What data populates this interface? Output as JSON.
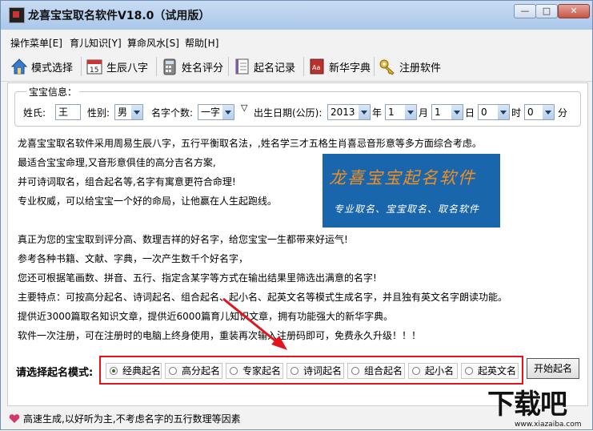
{
  "window": {
    "title": "龙喜宝宝取名软件V18.0（试用版）",
    "min_label": "—",
    "max_label": "□",
    "close_label": "✕"
  },
  "menu": [
    "操作菜单[E]",
    "育儿知识[Y]",
    "算命风水[S]",
    "帮助[H]"
  ],
  "toolbar": [
    {
      "label": "模式选择",
      "icon": "house-icon"
    },
    {
      "label": "生辰八字",
      "icon": "calendar-icon"
    },
    {
      "label": "姓名评分",
      "icon": "calculator-icon"
    },
    {
      "label": "起名记录",
      "icon": "notebook-icon"
    },
    {
      "label": "新华字典",
      "icon": "dictionary-icon"
    },
    {
      "label": "注册软件",
      "icon": "key-icon"
    }
  ],
  "baby_info": {
    "legend": "宝宝信息：",
    "surname_label": "姓氏:",
    "surname_value": "王",
    "gender_label": "性别:",
    "gender_value": "男",
    "name_count_label": "名字个数:",
    "name_count_value": "一字",
    "birthdate_label": "出生日期(公历):",
    "year": "2013",
    "year_unit": "年",
    "month": "1",
    "month_unit": "月",
    "day": "1",
    "day_unit": "日",
    "hour": "0",
    "hour_unit": "时",
    "minute": "0",
    "minute_unit": "分"
  },
  "description": {
    "p1": "龙喜宝宝取名软件采用周易生辰八字，五行平衡取名法，,姓名学三才五格生肖喜忌音形意等多方面综合考虑。",
    "p2": "最适合宝宝命理,又音形意俱佳的高分吉名方案,",
    "p3": "并可诗词取名，组合起名等,名字有寓意更符合命理!",
    "p4": "专业权威，可以给宝宝一个好的命局，让他赢在人生起跑线。",
    "p5": "真正为您的宝宝取到评分高、数理吉祥的好名字，给您宝宝一生都带来好运气!",
    "p6": "参考各种书籍、文献、字典，一次产生数千个好名字，",
    "p7": "您还可根据笔画数、拼音、五行、指定含某字等方式在输出结果里筛选出满意的名字!",
    "p8": "主要特点：可按高分起名、诗词起名、组合起名、起小名、起英文名等模式生成名字，并且独有英文名字朗读功能。",
    "p9": "提供近3000篇取名知识文章，提供近6000篇育儿知识文章，拥有功能强大的新华字典。",
    "p10": "软件一次注册，可在注册时的电脑上终身使用，重装再次输入注册码即可，免费永久升级！！！"
  },
  "banner": {
    "title": "龙喜宝宝起名软件",
    "subtitle": "专业取名、宝宝取名、取名软件"
  },
  "mode": {
    "label": "请选择起名模式:",
    "options": [
      "经典起名",
      "高分起名",
      "专家起名",
      "诗词起名",
      "组合起名",
      "起小名",
      "起英文名"
    ],
    "selected": "经典起名",
    "start_label": "开始起名"
  },
  "status": {
    "text": "高速生成,以好听为主,不考虑名字的五行数理等因素"
  },
  "watermark": {
    "main": "下载吧",
    "url": "www.xiazaiba.com"
  },
  "colors": {
    "highlight": "#e5131b",
    "banner_bg": "#1a66ad",
    "banner_title": "#f08f1e"
  }
}
